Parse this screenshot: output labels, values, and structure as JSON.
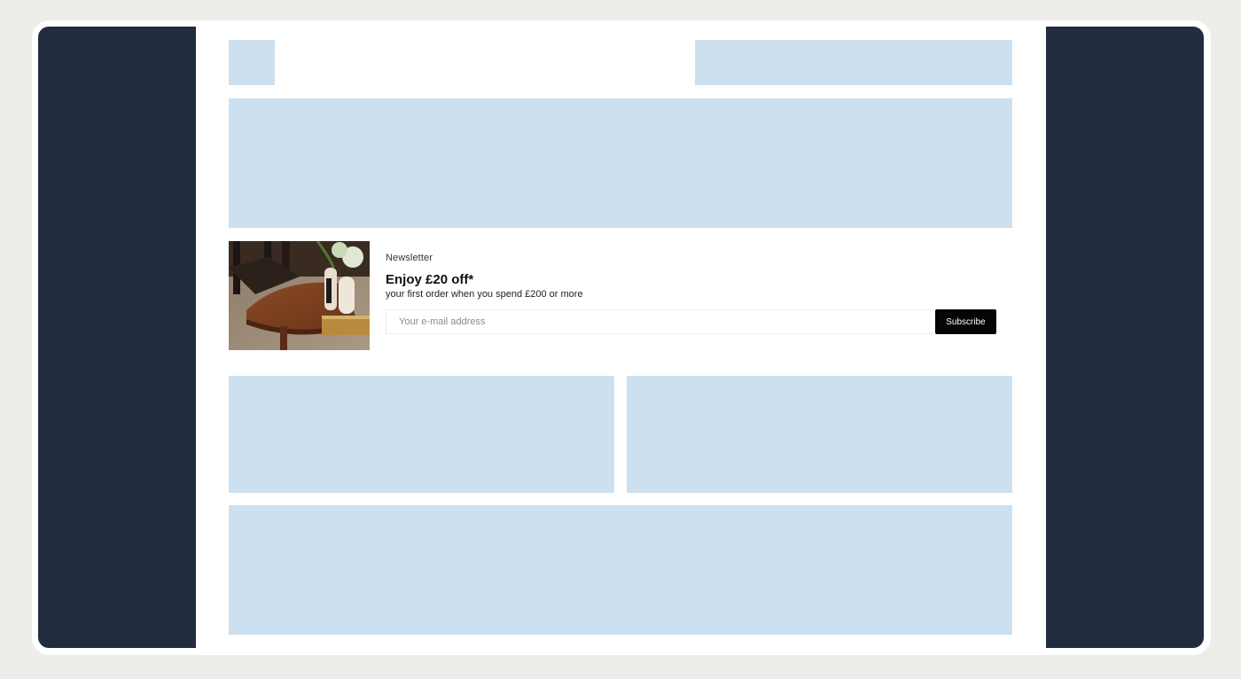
{
  "newsletter": {
    "eyebrow": "Newsletter",
    "title": "Enjoy £20 off*",
    "subtitle": "your first order when you spend £200 or more",
    "email_placeholder": "Your e-mail address",
    "subscribe_label": "Subscribe",
    "image_icon": "furniture-photo"
  },
  "colors": {
    "background": "#efedea",
    "sidebar": "#212d3e",
    "placeholder_block": "#cce0ef",
    "button": "#050505"
  }
}
